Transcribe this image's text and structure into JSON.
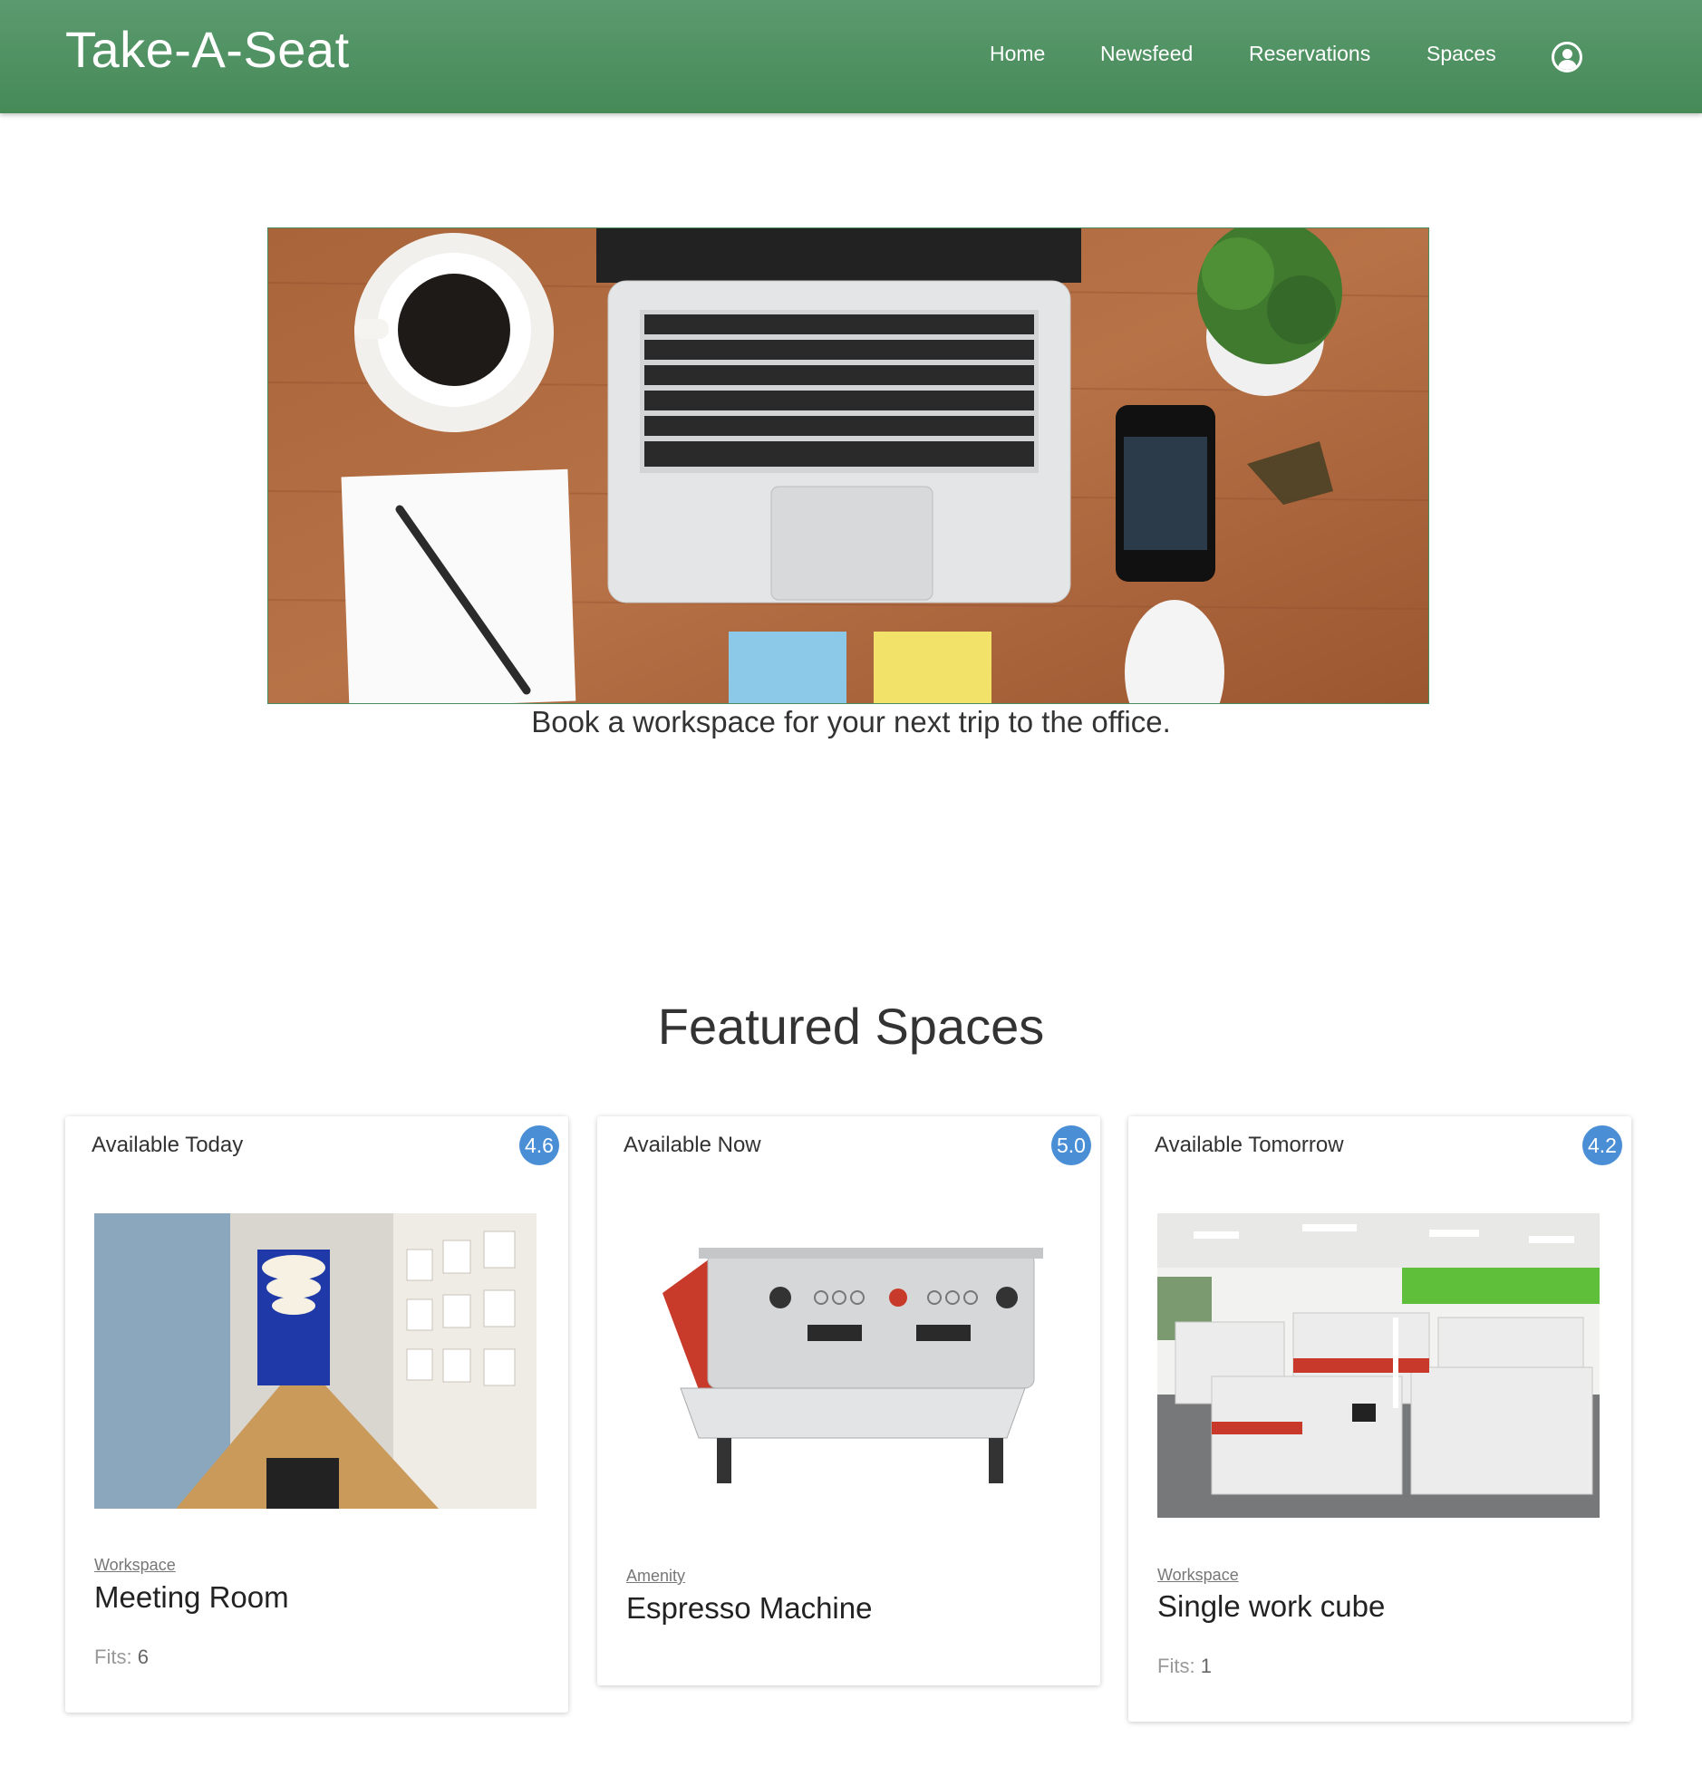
{
  "header": {
    "brand": "Take-A-Seat",
    "nav": [
      "Home",
      "Newsfeed",
      "Reservations",
      "Spaces"
    ],
    "profile_icon": "user-circle-icon",
    "bg_color": "#519462"
  },
  "hero": {
    "image": "desk-with-laptop-coffee-notebook-plant-phone",
    "tagline": "Book a workspace for your next trip to the office."
  },
  "featured": {
    "title": "Featured Spaces",
    "accent_color": "#4a8fd6",
    "cards": [
      {
        "availability": "Available Today",
        "rating": "4.6",
        "image": "meeting-room-photo",
        "category": "Workspace",
        "name": "Meeting Room",
        "fits_label": "Fits:",
        "fits_value": "6"
      },
      {
        "availability": "Available Now",
        "rating": "5.0",
        "image": "espresso-machine-photo",
        "category": "Amenity",
        "name": "Espresso Machine"
      },
      {
        "availability": "Available Tomorrow",
        "rating": "4.2",
        "image": "office-cubicles-photo",
        "category": "Workspace",
        "name": "Single work cube",
        "fits_label": "Fits:",
        "fits_value": "1"
      }
    ]
  }
}
